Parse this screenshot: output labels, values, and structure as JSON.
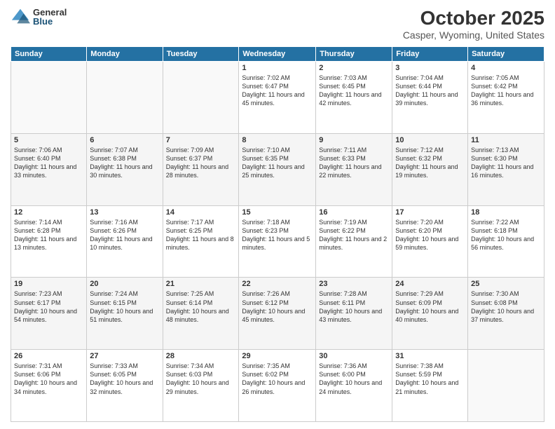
{
  "logo": {
    "general": "General",
    "blue": "Blue"
  },
  "title": "October 2025",
  "location": "Casper, Wyoming, United States",
  "days_of_week": [
    "Sunday",
    "Monday",
    "Tuesday",
    "Wednesday",
    "Thursday",
    "Friday",
    "Saturday"
  ],
  "weeks": [
    [
      {
        "num": "",
        "info": ""
      },
      {
        "num": "",
        "info": ""
      },
      {
        "num": "",
        "info": ""
      },
      {
        "num": "1",
        "info": "Sunrise: 7:02 AM\nSunset: 6:47 PM\nDaylight: 11 hours and 45 minutes."
      },
      {
        "num": "2",
        "info": "Sunrise: 7:03 AM\nSunset: 6:45 PM\nDaylight: 11 hours and 42 minutes."
      },
      {
        "num": "3",
        "info": "Sunrise: 7:04 AM\nSunset: 6:44 PM\nDaylight: 11 hours and 39 minutes."
      },
      {
        "num": "4",
        "info": "Sunrise: 7:05 AM\nSunset: 6:42 PM\nDaylight: 11 hours and 36 minutes."
      }
    ],
    [
      {
        "num": "5",
        "info": "Sunrise: 7:06 AM\nSunset: 6:40 PM\nDaylight: 11 hours and 33 minutes."
      },
      {
        "num": "6",
        "info": "Sunrise: 7:07 AM\nSunset: 6:38 PM\nDaylight: 11 hours and 30 minutes."
      },
      {
        "num": "7",
        "info": "Sunrise: 7:09 AM\nSunset: 6:37 PM\nDaylight: 11 hours and 28 minutes."
      },
      {
        "num": "8",
        "info": "Sunrise: 7:10 AM\nSunset: 6:35 PM\nDaylight: 11 hours and 25 minutes."
      },
      {
        "num": "9",
        "info": "Sunrise: 7:11 AM\nSunset: 6:33 PM\nDaylight: 11 hours and 22 minutes."
      },
      {
        "num": "10",
        "info": "Sunrise: 7:12 AM\nSunset: 6:32 PM\nDaylight: 11 hours and 19 minutes."
      },
      {
        "num": "11",
        "info": "Sunrise: 7:13 AM\nSunset: 6:30 PM\nDaylight: 11 hours and 16 minutes."
      }
    ],
    [
      {
        "num": "12",
        "info": "Sunrise: 7:14 AM\nSunset: 6:28 PM\nDaylight: 11 hours and 13 minutes."
      },
      {
        "num": "13",
        "info": "Sunrise: 7:16 AM\nSunset: 6:26 PM\nDaylight: 11 hours and 10 minutes."
      },
      {
        "num": "14",
        "info": "Sunrise: 7:17 AM\nSunset: 6:25 PM\nDaylight: 11 hours and 8 minutes."
      },
      {
        "num": "15",
        "info": "Sunrise: 7:18 AM\nSunset: 6:23 PM\nDaylight: 11 hours and 5 minutes."
      },
      {
        "num": "16",
        "info": "Sunrise: 7:19 AM\nSunset: 6:22 PM\nDaylight: 11 hours and 2 minutes."
      },
      {
        "num": "17",
        "info": "Sunrise: 7:20 AM\nSunset: 6:20 PM\nDaylight: 10 hours and 59 minutes."
      },
      {
        "num": "18",
        "info": "Sunrise: 7:22 AM\nSunset: 6:18 PM\nDaylight: 10 hours and 56 minutes."
      }
    ],
    [
      {
        "num": "19",
        "info": "Sunrise: 7:23 AM\nSunset: 6:17 PM\nDaylight: 10 hours and 54 minutes."
      },
      {
        "num": "20",
        "info": "Sunrise: 7:24 AM\nSunset: 6:15 PM\nDaylight: 10 hours and 51 minutes."
      },
      {
        "num": "21",
        "info": "Sunrise: 7:25 AM\nSunset: 6:14 PM\nDaylight: 10 hours and 48 minutes."
      },
      {
        "num": "22",
        "info": "Sunrise: 7:26 AM\nSunset: 6:12 PM\nDaylight: 10 hours and 45 minutes."
      },
      {
        "num": "23",
        "info": "Sunrise: 7:28 AM\nSunset: 6:11 PM\nDaylight: 10 hours and 43 minutes."
      },
      {
        "num": "24",
        "info": "Sunrise: 7:29 AM\nSunset: 6:09 PM\nDaylight: 10 hours and 40 minutes."
      },
      {
        "num": "25",
        "info": "Sunrise: 7:30 AM\nSunset: 6:08 PM\nDaylight: 10 hours and 37 minutes."
      }
    ],
    [
      {
        "num": "26",
        "info": "Sunrise: 7:31 AM\nSunset: 6:06 PM\nDaylight: 10 hours and 34 minutes."
      },
      {
        "num": "27",
        "info": "Sunrise: 7:33 AM\nSunset: 6:05 PM\nDaylight: 10 hours and 32 minutes."
      },
      {
        "num": "28",
        "info": "Sunrise: 7:34 AM\nSunset: 6:03 PM\nDaylight: 10 hours and 29 minutes."
      },
      {
        "num": "29",
        "info": "Sunrise: 7:35 AM\nSunset: 6:02 PM\nDaylight: 10 hours and 26 minutes."
      },
      {
        "num": "30",
        "info": "Sunrise: 7:36 AM\nSunset: 6:00 PM\nDaylight: 10 hours and 24 minutes."
      },
      {
        "num": "31",
        "info": "Sunrise: 7:38 AM\nSunset: 5:59 PM\nDaylight: 10 hours and 21 minutes."
      },
      {
        "num": "",
        "info": ""
      }
    ]
  ]
}
